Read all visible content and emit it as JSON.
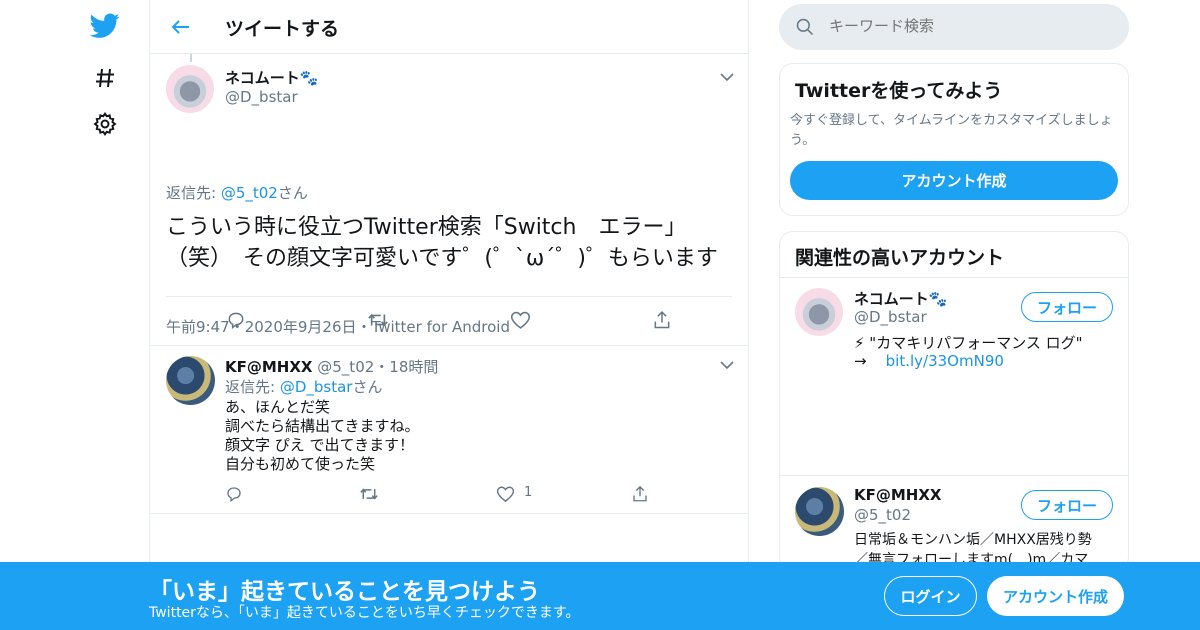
{
  "nav": {
    "logo_icon": "twitter-bird-icon",
    "explore_icon": "hashtag-icon",
    "settings_icon": "gear-icon"
  },
  "header": {
    "title": "ツイートする"
  },
  "focus_tweet": {
    "name": "ネコムート🐾",
    "handle": "@D_bstar",
    "reply_prefix": "返信先: ",
    "reply_handle": "@5_t02",
    "reply_suffix": "さん",
    "text": "こういう時に役立つTwitter検索「Switch　エラー」（笑）　その顔文字可愛いです゜(゜`ω´゜)゜もらいます",
    "time": "午前9:47",
    "date": "2020年9月26日",
    "source": "Twitter for Android",
    "sep": "・"
  },
  "reply_tweet": {
    "name": "KF@MHXX",
    "handle": "@5_t02",
    "dot": "・",
    "ago": "18時間",
    "reply_prefix": "返信先: ",
    "reply_handle": "@D_bstar",
    "reply_suffix": "さん",
    "lines": [
      "あ、ほんとだ笑",
      "調べたら結構出てきますね。",
      "顔文字 ぴえ で出てきます！",
      "自分も初めて使った笑"
    ],
    "like_count": "1"
  },
  "search": {
    "placeholder": "キーワード検索"
  },
  "signup_card": {
    "title": "Twitterを使ってみよう",
    "desc": "今すぐ登録して、タイムラインをカスタマイズしましょう。",
    "button": "アカウント作成"
  },
  "related": {
    "title": "関連性の高いアカウント",
    "accounts": [
      {
        "name": "ネコムート🐾",
        "handle": "@D_bstar",
        "follow": "フォロー",
        "bio1": "⚡ \"カマキリパフォーマンス ログ\"",
        "bio2_arrow": "→",
        "bio2_link": "bit.ly/33OmN90"
      },
      {
        "name": "KF@MHXX",
        "handle": "@5_t02",
        "follow": "フォロー",
        "bio1": "日常垢＆モンハン垢／MHXX居残り勢",
        "bio2": "／無言フォローしますm(__)m／カマ"
      }
    ]
  },
  "banner": {
    "title": "「いま」起きていることを見つけよう",
    "subtitle": "Twitterなら、「いま」起きていることをいち早くチェックできます。",
    "login": "ログイン",
    "signup": "アカウント作成"
  },
  "colors": {
    "accent": "#1da1f2",
    "link": "#1b95e0",
    "muted": "#657786",
    "border": "#e6ecf0"
  }
}
